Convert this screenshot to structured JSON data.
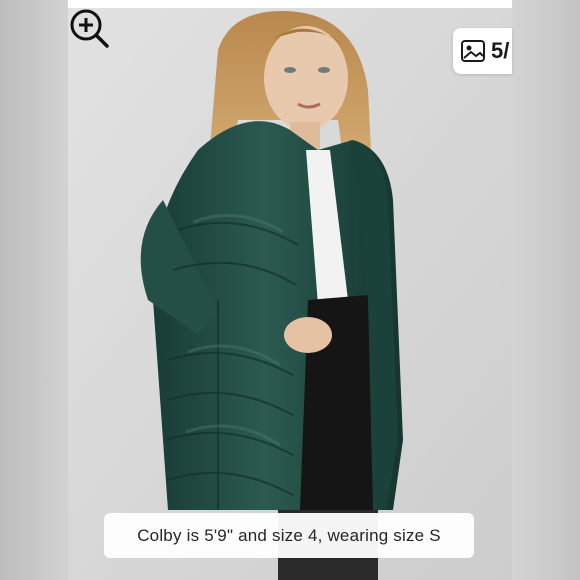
{
  "gallery": {
    "counter_text": "5/",
    "caption": "Colby is 5'9\" and size 4, wearing size S"
  },
  "icons": {
    "zoom": "zoom-in-icon",
    "gallery": "image-gallery-icon"
  },
  "colors": {
    "coat": "#1f4a42",
    "background": "#d8d8d8",
    "overlay": "#ffffff"
  }
}
